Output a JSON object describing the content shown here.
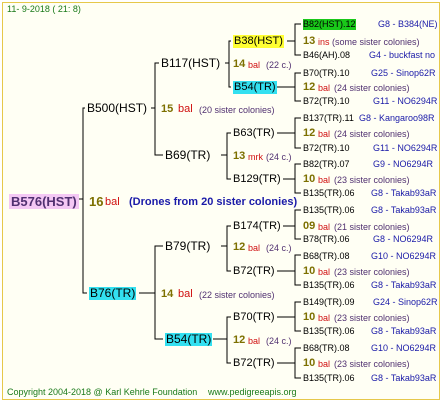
{
  "header": "11-  9-2018 ( 21:  8)",
  "footer": {
    "copyright": "Copyright 2004-2018 @ Karl Kehrle Foundation",
    "site": "www.pedigreeapis.org"
  },
  "root": {
    "name": "B576(HST)",
    "num": "16",
    "bal": "bal",
    "note": "(Drones from 20 sister colonies)"
  },
  "gen1": [
    {
      "name": "B500(HST)",
      "num": "15",
      "bal": "bal",
      "note": "(20 sister colonies)"
    },
    {
      "name": "B76(TR)",
      "num": "14",
      "bal": "bal",
      "note": "(22 sister colonies)"
    }
  ],
  "gen2": [
    {
      "name": "B117(HST)",
      "num": "14",
      "bal": "bal",
      "note": "(22 c.)"
    },
    {
      "name": "B69(TR)",
      "num": "13",
      "bal": "mrk",
      "note": "(24 c.)"
    },
    {
      "name": "B79(TR)",
      "num": "12",
      "bal": "bal",
      "note": "(24 c.)"
    },
    {
      "name": "B54(TR)",
      "num": "12",
      "bal": "bal",
      "note": "(24 c.)"
    }
  ],
  "gen3": [
    {
      "name": "B38(HST)",
      "num": "13",
      "bal": "ins",
      "note": "(some sister colonies)"
    },
    {
      "name": "B54(TR)",
      "num": "12",
      "bal": "bal",
      "note": "(24 sister colonies)"
    },
    {
      "name": "B63(TR)",
      "num": "12",
      "bal": "bal",
      "note": "(24 sister colonies)"
    },
    {
      "name": "B129(TR)",
      "num": "10",
      "bal": "bal",
      "note": "(23 sister colonies)"
    },
    {
      "name": "B174(TR)",
      "num": "09",
      "bal": "bal",
      "note": "(21 sister colonies)"
    },
    {
      "name": "B72(TR)",
      "num": "10",
      "bal": "bal",
      "note": "(23 sister colonies)"
    },
    {
      "name": "B70(TR)",
      "num": "10",
      "bal": "bal",
      "note": "(23 sister colonies)"
    },
    {
      "name": "B72(TR)",
      "num": "10",
      "bal": "bal",
      "note": "(23 sister colonies)"
    }
  ],
  "gen4": [
    {
      "left": "B82(HST).12",
      "right": "G8 - B384(NE)"
    },
    {
      "left": "B46(AH).08",
      "right": "G4 - buckfast no"
    },
    {
      "left": "B70(TR).10",
      "right": "G25 - Sinop62R"
    },
    {
      "left": "B72(TR).10",
      "right": "G11 - NO6294R"
    },
    {
      "left": "B137(TR).11",
      "right": "G8 - Kangaroo98R"
    },
    {
      "left": "B72(TR).10",
      "right": "G11 - NO6294R"
    },
    {
      "left": "B82(TR).07",
      "right": "G9 - NO6294R"
    },
    {
      "left": "B135(TR).06",
      "right": "G8 - Takab93aR"
    },
    {
      "left": "B135(TR).06",
      "right": "G8 - Takab93aR"
    },
    {
      "left": "B78(TR).06",
      "right": "G8 - NO6294R"
    },
    {
      "left": "B68(TR).08",
      "right": "G10 - NO6294R"
    },
    {
      "left": "B135(TR).06",
      "right": "G8 - Takab93aR"
    },
    {
      "left": "B149(TR).09",
      "right": "G24 - Sinop62R"
    },
    {
      "left": "B135(TR).06",
      "right": "G8 - Takab93aR"
    },
    {
      "left": "B68(TR).08",
      "right": "G10 - NO6294R"
    },
    {
      "left": "B135(TR).06",
      "right": "G8 - Takab93aR"
    }
  ],
  "colors": {
    "blue": "#1a1aa8",
    "red": "#d01010",
    "olive": "#7d7000",
    "yellow": "#ffff33",
    "cyan": "#33e0f0",
    "green": "#19c819",
    "pink": "#f4c8f4",
    "frame": "#e6c84a"
  }
}
